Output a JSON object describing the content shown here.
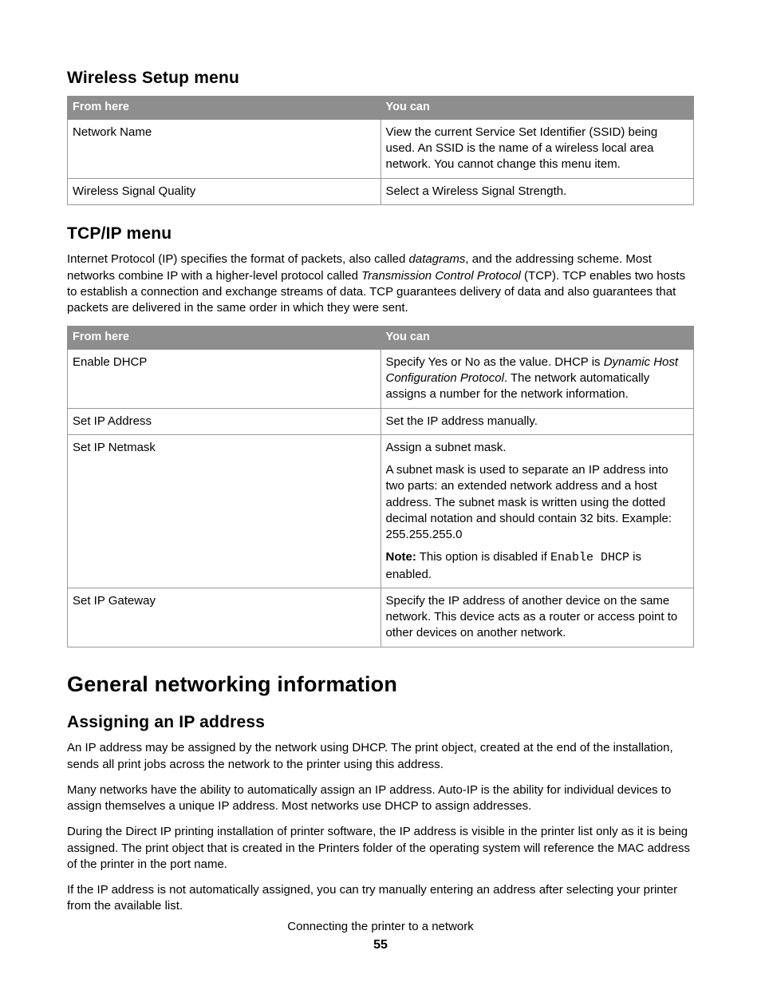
{
  "sections": {
    "wireless": {
      "heading": "Wireless Setup menu",
      "headers": {
        "col1": "From here",
        "col2": "You can"
      },
      "rows": [
        {
          "c1": "Network Name",
          "c2": "View the current Service Set Identifier (SSID) being used. An SSID is the name of a wireless local area network. You cannot change this menu item."
        },
        {
          "c1": "Wireless Signal Quality",
          "c2": "Select a Wireless Signal Strength."
        }
      ]
    },
    "tcpip": {
      "heading": "TCP/IP menu",
      "intro_pre": "Internet Protocol (IP) specifies the format of packets, also called ",
      "intro_ital1": "datagrams",
      "intro_mid": ", and the addressing scheme. Most networks combine IP with a higher-level protocol called ",
      "intro_ital2": "Transmission Control Protocol",
      "intro_post": " (TCP). TCP enables two hosts to establish a connection and exchange streams of data. TCP guarantees delivery of data and also guarantees that packets are delivered in the same order in which they were sent.",
      "headers": {
        "col1": "From here",
        "col2": "You can"
      },
      "rows": {
        "r1": {
          "c1": "Enable DHCP",
          "c2_pre": "Specify Yes or No as the value. DHCP is ",
          "c2_ital": "Dynamic Host Configuration Protocol",
          "c2_post": ". The network automatically assigns a number for the network information."
        },
        "r2": {
          "c1": "Set IP Address",
          "c2": "Set the IP address manually."
        },
        "r3": {
          "c1": "Set IP Netmask",
          "p1": "Assign a subnet mask.",
          "p2": "A subnet mask is used to separate an IP address into two parts: an extended network address and a host address. The subnet mask is written using the dotted decimal notation and should contain 32 bits. Example: 255.255.255.0",
          "note_label": "Note:",
          "note_pre": " This option is disabled if ",
          "note_code": "Enable DHCP",
          "note_post": " is enabled."
        },
        "r4": {
          "c1": "Set IP Gateway",
          "c2": "Specify the IP address of another device on the same network. This device acts as a router or access point to other devices on another network."
        }
      }
    },
    "general": {
      "heading": "General networking information",
      "sub_heading": "Assigning an IP address",
      "p1": "An IP address may be assigned by the network using DHCP. The print object, created at the end of the installation, sends all print jobs across the network to the printer using this address.",
      "p2": "Many networks have the ability to automatically assign an IP address. Auto-IP is the ability for individual devices to assign themselves a unique IP address. Most networks use DHCP to assign addresses.",
      "p3": "During the Direct IP printing installation of printer software, the IP address is visible in the printer list only as it is being assigned. The print object that is created in the Printers folder of the operating system will reference the MAC address of the printer in the port name.",
      "p4": "If the IP address is not automatically assigned, you can try manually entering an address after selecting your printer from the available list."
    }
  },
  "footer": {
    "title": "Connecting the printer to a network",
    "page": "55"
  }
}
